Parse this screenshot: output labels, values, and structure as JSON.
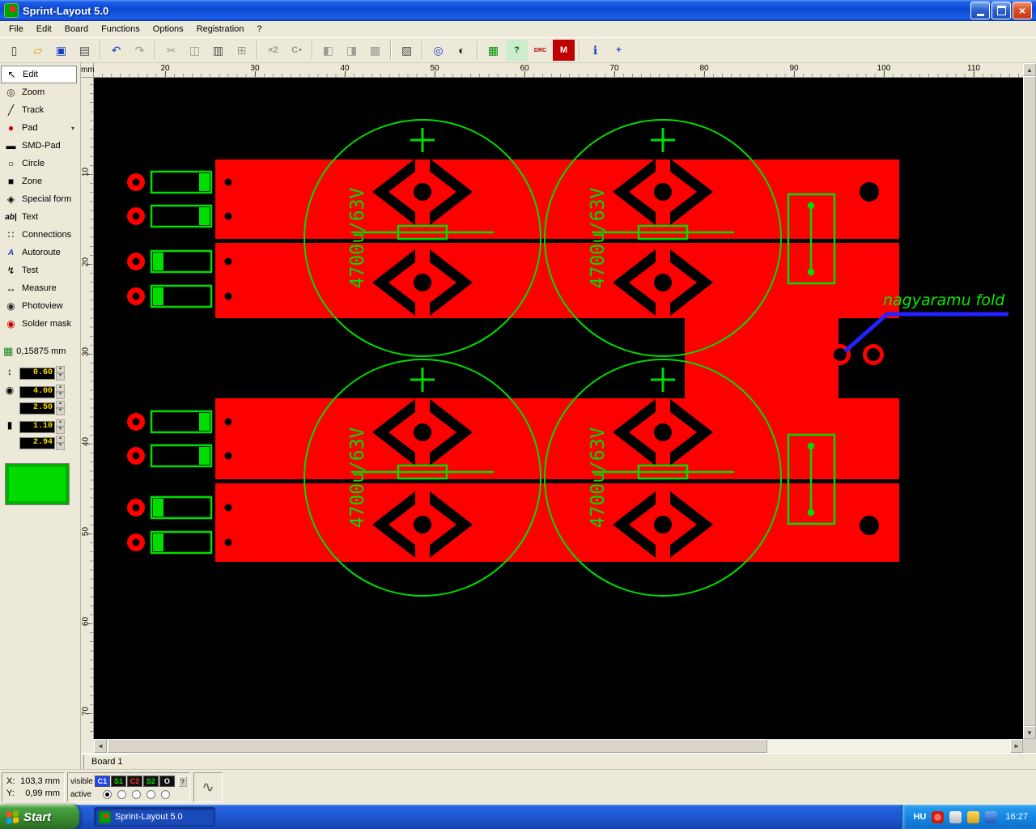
{
  "titlebar": {
    "title": "Sprint-Layout 5.0",
    "close_glyph": "×"
  },
  "menu": {
    "items": [
      "File",
      "Edit",
      "Board",
      "Functions",
      "Options",
      "Registration",
      "?"
    ]
  },
  "toolbar": {
    "buttons": [
      {
        "name": "new",
        "glyph": "▯",
        "color": "#404040"
      },
      {
        "name": "open",
        "glyph": "▱",
        "color": "#caa002"
      },
      {
        "name": "save",
        "glyph": "▣",
        "color": "#1f3fbf"
      },
      {
        "name": "print",
        "glyph": "▤",
        "color": "#505050"
      },
      {
        "sep": true
      },
      {
        "name": "undo",
        "glyph": "↶",
        "color": "#1f3fbf"
      },
      {
        "name": "redo",
        "glyph": "↷",
        "color": "#9c9a93",
        "disabled": true
      },
      {
        "sep": true
      },
      {
        "name": "cut",
        "glyph": "✂",
        "color": "#9c9a93",
        "disabled": true
      },
      {
        "name": "copy",
        "glyph": "◫",
        "color": "#9c9a93",
        "disabled": true
      },
      {
        "name": "paste",
        "glyph": "▥",
        "color": "#505050"
      },
      {
        "name": "duplicate",
        "glyph": "⊞",
        "color": "#9c9a93",
        "disabled": true
      },
      {
        "sep": true
      },
      {
        "name": "scale-x2",
        "glyph": "×2",
        "color": "#9c9a93",
        "disabled": true,
        "text": true
      },
      {
        "name": "rotate",
        "glyph": "C",
        "color": "#9c9a93",
        "disabled": true,
        "text": true,
        "dropdown": true
      },
      {
        "sep": true
      },
      {
        "name": "mirror-horizontal",
        "glyph": "◧",
        "color": "#9c9a93",
        "disabled": true
      },
      {
        "name": "mirror-vertical",
        "glyph": "◨",
        "color": "#9c9a93",
        "disabled": true
      },
      {
        "name": "align",
        "glyph": "▩",
        "color": "#9c9a93",
        "disabled": true
      },
      {
        "sep": true
      },
      {
        "name": "ratsnest",
        "glyph": "▨",
        "color": "#505050"
      },
      {
        "sep": true
      },
      {
        "name": "zoom-all",
        "glyph": "◎",
        "color": "#1f3fbf"
      },
      {
        "name": "photoview-contrast",
        "glyph": "◐",
        "color": "#202020"
      },
      {
        "sep": true
      },
      {
        "name": "layers-check",
        "glyph": "▦",
        "color": "#00920a"
      },
      {
        "name": "connection-test",
        "glyph": "?",
        "color": "#006a06",
        "text": true,
        "bg": "#cdebcd"
      },
      {
        "name": "drc",
        "glyph": "DRC",
        "color": "#b40000",
        "text": true,
        "small": true
      },
      {
        "name": "macros",
        "glyph": "M",
        "color": "#ffffff",
        "text": true,
        "bg": "#c00000"
      },
      {
        "sep": true
      },
      {
        "name": "info",
        "glyph": "ℹ",
        "color": "#1f3fbf"
      },
      {
        "name": "origin",
        "glyph": "+",
        "color": "#1f3fbf",
        "text": true
      }
    ]
  },
  "tools": {
    "items": [
      {
        "name": "edit",
        "label": "Edit",
        "glyph": "↖",
        "color": "#000000",
        "active": true
      },
      {
        "name": "zoom",
        "label": "Zoom",
        "glyph": "◎",
        "color": "#303030"
      },
      {
        "name": "track",
        "label": "Track",
        "glyph": "╱",
        "color": "#000000"
      },
      {
        "name": "pad",
        "label": "Pad",
        "glyph": "●",
        "color": "#cc0000",
        "dropdown": true
      },
      {
        "name": "smd-pad",
        "label": "SMD-Pad",
        "glyph": "▬",
        "color": "#000000"
      },
      {
        "name": "circle",
        "label": "Circle",
        "glyph": "○",
        "color": "#000000"
      },
      {
        "name": "zone",
        "label": "Zone",
        "glyph": "■",
        "color": "#000000"
      },
      {
        "name": "special-form",
        "label": "Special form",
        "glyph": "◈",
        "color": "#000000"
      },
      {
        "name": "text",
        "label": "Text",
        "glyph": "ab|",
        "color": "#000000",
        "text": true
      },
      {
        "name": "connections",
        "label": "Connections",
        "glyph": "∷",
        "color": "#000000"
      },
      {
        "name": "autoroute",
        "label": "Autoroute",
        "glyph": "A",
        "color": "#1f3fbf",
        "text": true
      },
      {
        "name": "test",
        "label": "Test",
        "glyph": "↯",
        "color": "#000000"
      },
      {
        "name": "measure",
        "label": "Measure",
        "glyph": "↔",
        "color": "#000000"
      },
      {
        "name": "photoview",
        "label": "Photoview",
        "glyph": "◉",
        "color": "#303030"
      },
      {
        "name": "solder-mask",
        "label": "Solder mask",
        "glyph": "◉",
        "color": "#cc0000"
      }
    ]
  },
  "grid": {
    "icon": "▦",
    "value": "0,15875 mm"
  },
  "params": {
    "track": {
      "icon": "↕",
      "width": "0.60"
    },
    "pad": {
      "icon": "◉",
      "outer": "4.00",
      "inner": "2.50"
    },
    "smd": {
      "icon": "▮",
      "width": "1.10",
      "height": "2.94"
    }
  },
  "rulers": {
    "unit": "mm",
    "h_labels": [
      "20",
      "30",
      "40",
      "50",
      "60",
      "70",
      "80",
      "90",
      "100",
      "110"
    ],
    "v_labels": [
      "10",
      "20",
      "30",
      "40",
      "50",
      "60",
      "70"
    ]
  },
  "scroll": {
    "left": "◄",
    "right": "►",
    "up": "▲",
    "down": "▼"
  },
  "board_tabs": [
    "Board 1"
  ],
  "status": {
    "x_label": "X:",
    "x_value": "103,3 mm",
    "y_label": "Y:",
    "y_value": "0,99 mm",
    "visible_label": "visible",
    "active_label": "active",
    "help_label": "?",
    "mode_icon": "∿",
    "layers": [
      {
        "id": "C1",
        "fg": "#ffffff",
        "bg": "#2244ee"
      },
      {
        "id": "S1",
        "fg": "#00dd00",
        "bg": "#101010"
      },
      {
        "id": "C2",
        "fg": "#ff3030",
        "bg": "#101010"
      },
      {
        "id": "S2",
        "fg": "#00dd00",
        "bg": "#101010"
      },
      {
        "id": "O",
        "fg": "#ffffff",
        "bg": "#101010"
      }
    ],
    "active_index": 0
  },
  "taskbar": {
    "start_label": "Start",
    "task_label": "Sprint-Layout 5.0",
    "language": "HU",
    "clock": "16:27"
  },
  "pcb": {
    "cap_label": "4700u/63V",
    "note": "nagyaramu fold",
    "copper_color": "#ff0000",
    "silk_color": "#00dd00",
    "trace_color": "#2222ff"
  }
}
